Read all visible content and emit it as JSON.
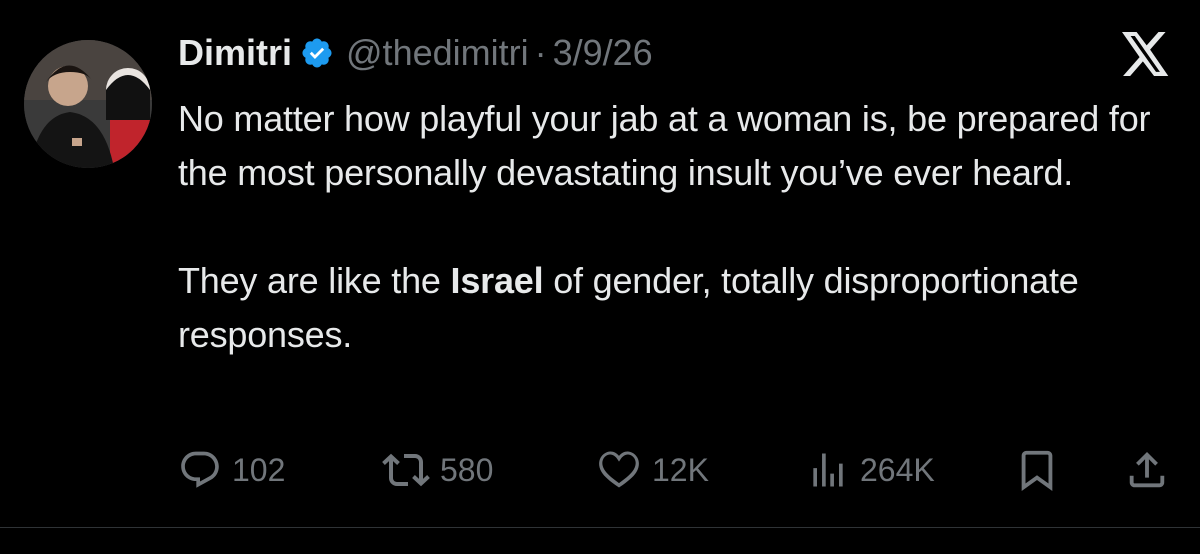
{
  "author": {
    "display_name": "Dimitri",
    "handle": "@thedimitri",
    "separator": "·",
    "date": "3/9/26",
    "verified_color": "#1d9bf0"
  },
  "tweet": {
    "paragraph1": "No matter how playful your jab at a woman is, be prepared for the most personally devastating insult you’ve ever heard.",
    "paragraph2_before": "They are like the ",
    "paragraph2_bold": "Israel",
    "paragraph2_after": " of gender, totally disproportionate responses."
  },
  "metrics": {
    "replies": "102",
    "reposts": "580",
    "likes": "12K",
    "views": "264K"
  },
  "icons": [
    "reply-icon",
    "repost-icon",
    "like-icon",
    "views-icon",
    "bookmark-icon",
    "share-icon",
    "x-logo-icon",
    "verified-badge-icon"
  ],
  "colors": {
    "background": "#000000",
    "text": "#e7e9ea",
    "secondary": "#71767b"
  }
}
